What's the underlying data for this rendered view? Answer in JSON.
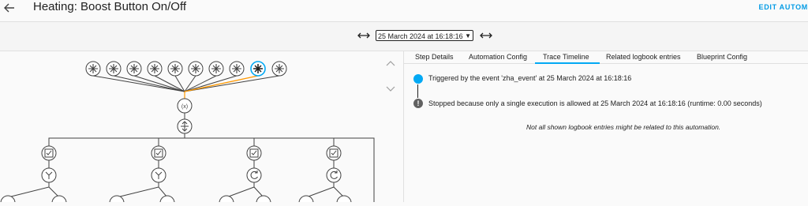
{
  "header": {
    "title": "Heating: Boost Button On/Off",
    "edit_label": "EDIT AUTOM"
  },
  "trace_selector": {
    "selected": "25 March 2024 at 16:18:16"
  },
  "tabs": [
    {
      "label": "Step Details"
    },
    {
      "label": "Automation Config"
    },
    {
      "label": "Trace Timeline"
    },
    {
      "label": "Related logbook entries"
    },
    {
      "label": "Blueprint Config"
    }
  ],
  "timeline": {
    "triggered": "Triggered by the event 'zha_event' at 25 March 2024 at 16:18:16",
    "stopped": "Stopped because only a single execution is allowed at 25 March 2024 at 16:18:16 (runtime: 0.00 seconds)",
    "note": "Not all shown logbook entries might be related to this automation."
  },
  "colors": {
    "accent": "#03a9f4",
    "trace_path": "#ff9800",
    "node_stroke": "#424242"
  },
  "icons": {
    "trigger": "asterisk-icon",
    "variables": "variable-icon",
    "choose": "choose-icon",
    "condition": "checkbox-icon",
    "split": "split-icon",
    "repeat": "repeat-icon"
  },
  "graph": {
    "triggers_count": 10,
    "active_trigger_index": 8
  }
}
